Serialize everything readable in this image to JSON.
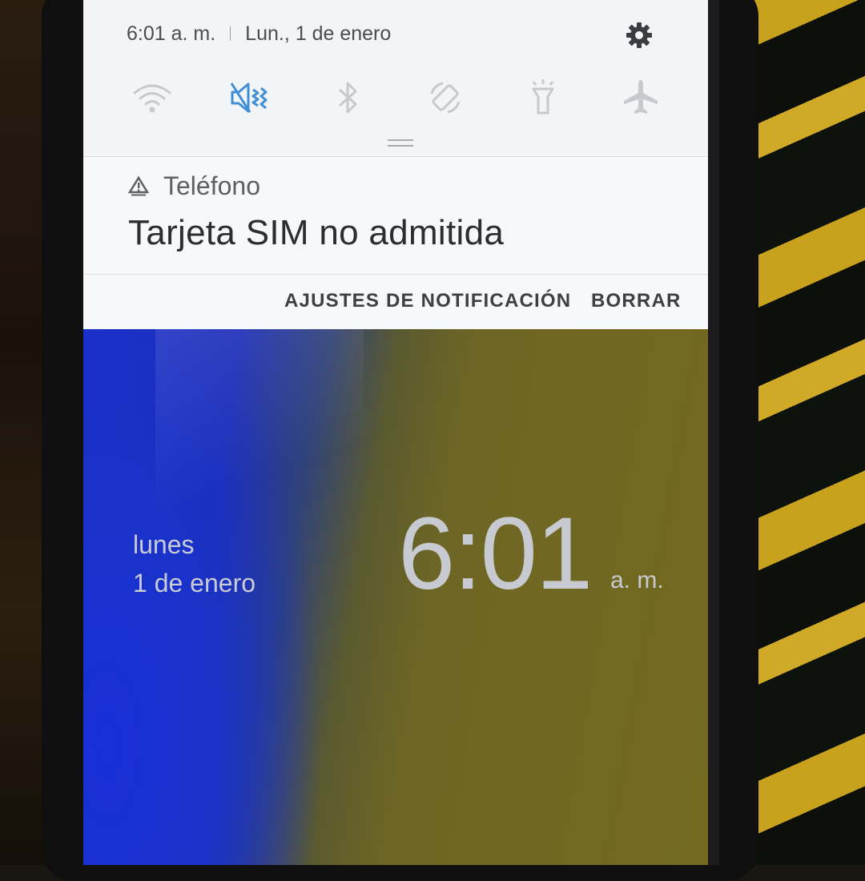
{
  "status_bar": {
    "time": "6:01 a. m.",
    "date": "Lun., 1 de enero",
    "settings_icon": "gear-icon"
  },
  "quick_settings": [
    {
      "icon": "wifi-icon",
      "active": false
    },
    {
      "icon": "sound-mute-icon",
      "active": true
    },
    {
      "icon": "bluetooth-icon",
      "active": false
    },
    {
      "icon": "auto-rotate-icon",
      "active": false
    },
    {
      "icon": "flashlight-icon",
      "active": false
    },
    {
      "icon": "airplane-mode-icon",
      "active": false
    }
  ],
  "notification": {
    "app_name": "Teléfono",
    "title": "Tarjeta SIM no admitida",
    "actions": {
      "settings": "AJUSTES DE NOTIFICACIÓN",
      "clear": "BORRAR"
    }
  },
  "lock_screen": {
    "day": "lunes",
    "date": "1 de enero",
    "time": "6:01",
    "ampm": "a. m."
  },
  "colors": {
    "accent": "#3f8fd8",
    "icon_inactive": "#c3c6cb",
    "shade_bg": "#f3f4f6"
  }
}
